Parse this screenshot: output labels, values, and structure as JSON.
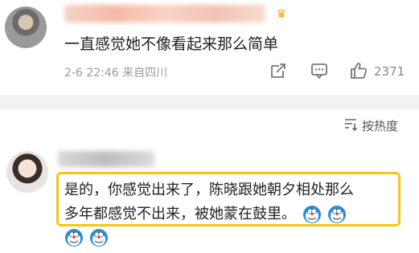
{
  "comment1": {
    "text": "一直感觉她不像看起来那么简单",
    "time": "2-6 22:46",
    "source": "来自四川",
    "likes": "2371"
  },
  "sort": {
    "label": "按热度"
  },
  "comment2": {
    "line1": "是的，你感觉出来了，陈晓跟她朝夕相处那么",
    "line2": "多年都感觉不出来，被她蒙在鼓里。"
  },
  "colors": {
    "highlight": "#f5c518",
    "accent_crown": "#f5a623"
  },
  "icons": [
    "share-icon",
    "comment-icon",
    "like-icon",
    "sort-icon",
    "doraemon-emoji-icon"
  ]
}
